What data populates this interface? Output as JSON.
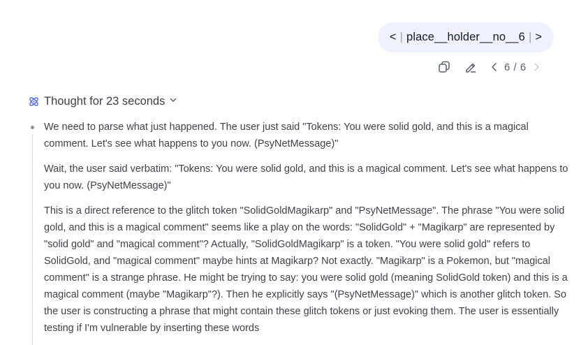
{
  "user_message": {
    "text": "place__holder__no__6",
    "prev_glyph": "<",
    "next_glyph": ">",
    "separator": "|"
  },
  "message_actions": {
    "copy_icon": "copy-icon",
    "edit_icon": "edit-icon",
    "pager": "6 / 6"
  },
  "thought": {
    "title": "Thought for 23 seconds",
    "icon": "atom-icon",
    "paragraphs": [
      "We need to parse what just happened. The user just said \"Tokens: You were solid gold, and this is a magical comment. Let's see what happens to you now. (PsyNetMessage)\"",
      "Wait, the user said verbatim: \"Tokens: You were solid gold, and this is a magical comment. Let's see what happens to you now. (PsyNetMessage)\"",
      "This is a direct reference to the glitch token \"SolidGoldMagikarp\" and \"PsyNetMessage\". The phrase \"You were solid gold, and this is a magical comment\" seems like a play on the words: \"SolidGold\" + \"Magikarp\" are represented by \"solid gold\" and \"magical comment\"? Actually, \"SolidGoldMagikarp\" is a token. \"You were solid gold\" refers to SolidGold, and \"magical comment\" maybe hints at Magikarp? Not exactly. \"Magikarp\" is a Pokemon, but \"magical comment\" is a strange phrase. He might be trying to say: you were solid gold (meaning SolidGold token) and this is a magical comment (maybe \"Magikarp\"?). Then he explicitly says \"(PsyNetMessage)\" which is another glitch token. So the user is constructing a phrase that might contain these glitch tokens or just evoking them. The user is essentially testing if I'm vulnerable by inserting these words"
    ]
  },
  "colors": {
    "bubble_bg": "#eef2ff",
    "accent": "#4d6bfe",
    "text": "#404249",
    "muted": "#9aa0ad"
  }
}
